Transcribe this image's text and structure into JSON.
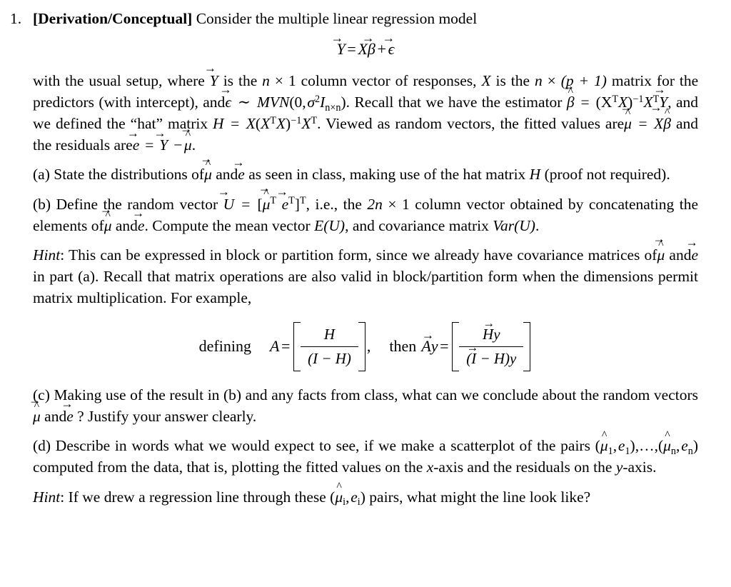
{
  "document": {
    "type": "homework-problem",
    "background_color": "#ffffff",
    "text_color": "#000000"
  },
  "problem": {
    "number": "1.",
    "tag": "[Derivation/Conceptual]",
    "lead_in": "Consider the multiple linear regression model"
  },
  "equation_model": {
    "lhs": "Y",
    "relation": "=",
    "term1_matrix": "X",
    "term1_vector": "β",
    "plus": "+",
    "term2": "ϵ",
    "plain": "Y⃗ = Xβ⃗ + ϵ⃗"
  },
  "setup": {
    "s1": "with the usual setup, where",
    "s2": "is the",
    "n": "n",
    "times": "×",
    "one": "1",
    "s3": "column vector of responses,",
    "X": "X",
    "s4": "is the",
    "p_plus_1": "(p + 1)",
    "s5": "matrix for the predictors (with intercept), and",
    "epsilon": "ϵ",
    "sim": "∼",
    "mvn": "MVN",
    "mvn_args_0": "0",
    "sigma": "σ",
    "sigma_pow": "2",
    "I": "I",
    "I_sub": "n×n",
    "s6": "Recall that we have the estimator",
    "beta": "β",
    "XtX": "(X",
    "T": "T",
    "s7": "and we defined the",
    "hat_quoted": "“hat”",
    "s8": "matrix",
    "H": "H",
    "s9": "Viewed as random vectors, the fitted values are",
    "mu": "μ",
    "s10": "and the residuals are",
    "e": "e",
    "Y": "Y"
  },
  "parts": {
    "a": {
      "label": "(a)",
      "t1": "State the distributions of",
      "mu": "μ",
      "t2": "and",
      "e": "e",
      "t3": "as seen in class, making use of the hat matrix",
      "H": "H",
      "t4": "(proof not required)."
    },
    "b": {
      "label": "(b)",
      "t1": "Define the random vector",
      "U": "U",
      "eq": "=",
      "mu": "μ",
      "T": "T",
      "e": "e",
      "t2": ", i.e., the",
      "two_n": "2n",
      "times": "×",
      "one": "1",
      "t3": "column vector obtained by concatenating the elements of",
      "t4": "and",
      "t5": "Compute the mean vector",
      "EU": "E(U)",
      "t6": ", and covariance matrix",
      "VarU": "Var(U)",
      "t7": "."
    },
    "hint_b": {
      "label": "Hint",
      "t1": ": This can be expressed in block or partition form, since we already have covariance matrices of",
      "mu": "μ",
      "t2": "and",
      "e": "e",
      "t3": "in part (a). Recall that matrix operations are also valid in block/partition form when the dimensions permit matrix multiplication. For example,"
    },
    "c": {
      "label": "(c)",
      "t1": "Making use of the result in (b) and any facts from class, what can we conclude about the random vectors",
      "mu": "μ",
      "t2": "and",
      "e": "e",
      "t3": "? Justify your answer clearly."
    },
    "d": {
      "label": "(d)",
      "t1": "Describe in words what we would expect to see, if we make a scatterplot of the pairs",
      "pair1_mu": "μ",
      "pair1_sub": "1",
      "pair1_e": "e",
      "ellipsis": ",…,",
      "pairn_mu": "μ",
      "pairn_sub": "n",
      "pairn_e": "e",
      "t2": "computed from the data, that is, plotting the fitted values on the",
      "x": "x",
      "t3": "-axis and the residuals on the",
      "y": "y",
      "t4": "-axis."
    },
    "hint_d": {
      "label": "Hint",
      "t1": ": If we drew a regression line through these",
      "mu": "μ",
      "sub_i": "i",
      "e": "e",
      "t2": "pairs, what might the line look like?"
    }
  },
  "equation_block": {
    "defining_word": "defining",
    "A": "A",
    "eq1": "=",
    "A_top": "H",
    "A_bottom": "(I − H)",
    "comma": ",",
    "then_word": "then",
    "Ay_A": "A",
    "Ay_y": "y",
    "eq2": "=",
    "Ay_top_H": "H",
    "Ay_top_y": "y",
    "Ay_bot_IH": "(I − H)",
    "Ay_bot_y": "y"
  }
}
